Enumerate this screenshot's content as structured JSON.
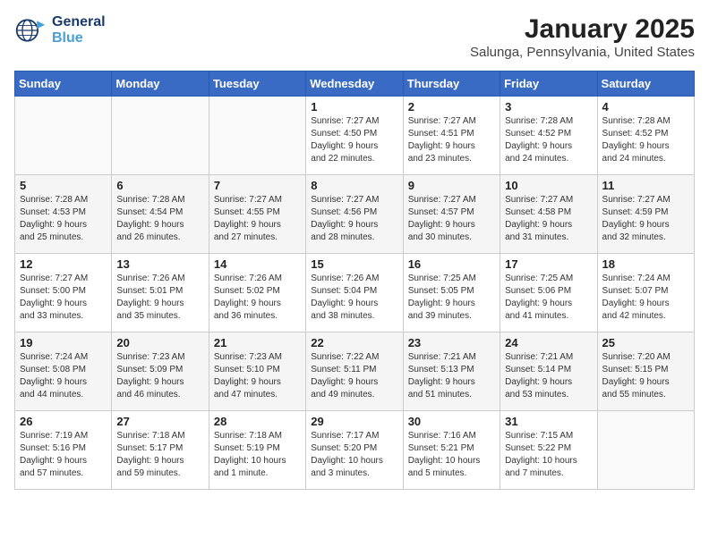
{
  "app": {
    "name": "GeneralBlue",
    "logo_text_line1": "General",
    "logo_text_line2": "Blue"
  },
  "calendar": {
    "title": "January 2025",
    "subtitle": "Salunga, Pennsylvania, United States"
  },
  "days_of_week": [
    "Sunday",
    "Monday",
    "Tuesday",
    "Wednesday",
    "Thursday",
    "Friday",
    "Saturday"
  ],
  "weeks": [
    [
      {
        "day": "",
        "info": ""
      },
      {
        "day": "",
        "info": ""
      },
      {
        "day": "",
        "info": ""
      },
      {
        "day": "1",
        "info": "Sunrise: 7:27 AM\nSunset: 4:50 PM\nDaylight: 9 hours\nand 22 minutes."
      },
      {
        "day": "2",
        "info": "Sunrise: 7:27 AM\nSunset: 4:51 PM\nDaylight: 9 hours\nand 23 minutes."
      },
      {
        "day": "3",
        "info": "Sunrise: 7:28 AM\nSunset: 4:52 PM\nDaylight: 9 hours\nand 24 minutes."
      },
      {
        "day": "4",
        "info": "Sunrise: 7:28 AM\nSunset: 4:52 PM\nDaylight: 9 hours\nand 24 minutes."
      }
    ],
    [
      {
        "day": "5",
        "info": "Sunrise: 7:28 AM\nSunset: 4:53 PM\nDaylight: 9 hours\nand 25 minutes."
      },
      {
        "day": "6",
        "info": "Sunrise: 7:28 AM\nSunset: 4:54 PM\nDaylight: 9 hours\nand 26 minutes."
      },
      {
        "day": "7",
        "info": "Sunrise: 7:27 AM\nSunset: 4:55 PM\nDaylight: 9 hours\nand 27 minutes."
      },
      {
        "day": "8",
        "info": "Sunrise: 7:27 AM\nSunset: 4:56 PM\nDaylight: 9 hours\nand 28 minutes."
      },
      {
        "day": "9",
        "info": "Sunrise: 7:27 AM\nSunset: 4:57 PM\nDaylight: 9 hours\nand 30 minutes."
      },
      {
        "day": "10",
        "info": "Sunrise: 7:27 AM\nSunset: 4:58 PM\nDaylight: 9 hours\nand 31 minutes."
      },
      {
        "day": "11",
        "info": "Sunrise: 7:27 AM\nSunset: 4:59 PM\nDaylight: 9 hours\nand 32 minutes."
      }
    ],
    [
      {
        "day": "12",
        "info": "Sunrise: 7:27 AM\nSunset: 5:00 PM\nDaylight: 9 hours\nand 33 minutes."
      },
      {
        "day": "13",
        "info": "Sunrise: 7:26 AM\nSunset: 5:01 PM\nDaylight: 9 hours\nand 35 minutes."
      },
      {
        "day": "14",
        "info": "Sunrise: 7:26 AM\nSunset: 5:02 PM\nDaylight: 9 hours\nand 36 minutes."
      },
      {
        "day": "15",
        "info": "Sunrise: 7:26 AM\nSunset: 5:04 PM\nDaylight: 9 hours\nand 38 minutes."
      },
      {
        "day": "16",
        "info": "Sunrise: 7:25 AM\nSunset: 5:05 PM\nDaylight: 9 hours\nand 39 minutes."
      },
      {
        "day": "17",
        "info": "Sunrise: 7:25 AM\nSunset: 5:06 PM\nDaylight: 9 hours\nand 41 minutes."
      },
      {
        "day": "18",
        "info": "Sunrise: 7:24 AM\nSunset: 5:07 PM\nDaylight: 9 hours\nand 42 minutes."
      }
    ],
    [
      {
        "day": "19",
        "info": "Sunrise: 7:24 AM\nSunset: 5:08 PM\nDaylight: 9 hours\nand 44 minutes."
      },
      {
        "day": "20",
        "info": "Sunrise: 7:23 AM\nSunset: 5:09 PM\nDaylight: 9 hours\nand 46 minutes."
      },
      {
        "day": "21",
        "info": "Sunrise: 7:23 AM\nSunset: 5:10 PM\nDaylight: 9 hours\nand 47 minutes."
      },
      {
        "day": "22",
        "info": "Sunrise: 7:22 AM\nSunset: 5:11 PM\nDaylight: 9 hours\nand 49 minutes."
      },
      {
        "day": "23",
        "info": "Sunrise: 7:21 AM\nSunset: 5:13 PM\nDaylight: 9 hours\nand 51 minutes."
      },
      {
        "day": "24",
        "info": "Sunrise: 7:21 AM\nSunset: 5:14 PM\nDaylight: 9 hours\nand 53 minutes."
      },
      {
        "day": "25",
        "info": "Sunrise: 7:20 AM\nSunset: 5:15 PM\nDaylight: 9 hours\nand 55 minutes."
      }
    ],
    [
      {
        "day": "26",
        "info": "Sunrise: 7:19 AM\nSunset: 5:16 PM\nDaylight: 9 hours\nand 57 minutes."
      },
      {
        "day": "27",
        "info": "Sunrise: 7:18 AM\nSunset: 5:17 PM\nDaylight: 9 hours\nand 59 minutes."
      },
      {
        "day": "28",
        "info": "Sunrise: 7:18 AM\nSunset: 5:19 PM\nDaylight: 10 hours\nand 1 minute."
      },
      {
        "day": "29",
        "info": "Sunrise: 7:17 AM\nSunset: 5:20 PM\nDaylight: 10 hours\nand 3 minutes."
      },
      {
        "day": "30",
        "info": "Sunrise: 7:16 AM\nSunset: 5:21 PM\nDaylight: 10 hours\nand 5 minutes."
      },
      {
        "day": "31",
        "info": "Sunrise: 7:15 AM\nSunset: 5:22 PM\nDaylight: 10 hours\nand 7 minutes."
      },
      {
        "day": "",
        "info": ""
      }
    ]
  ]
}
